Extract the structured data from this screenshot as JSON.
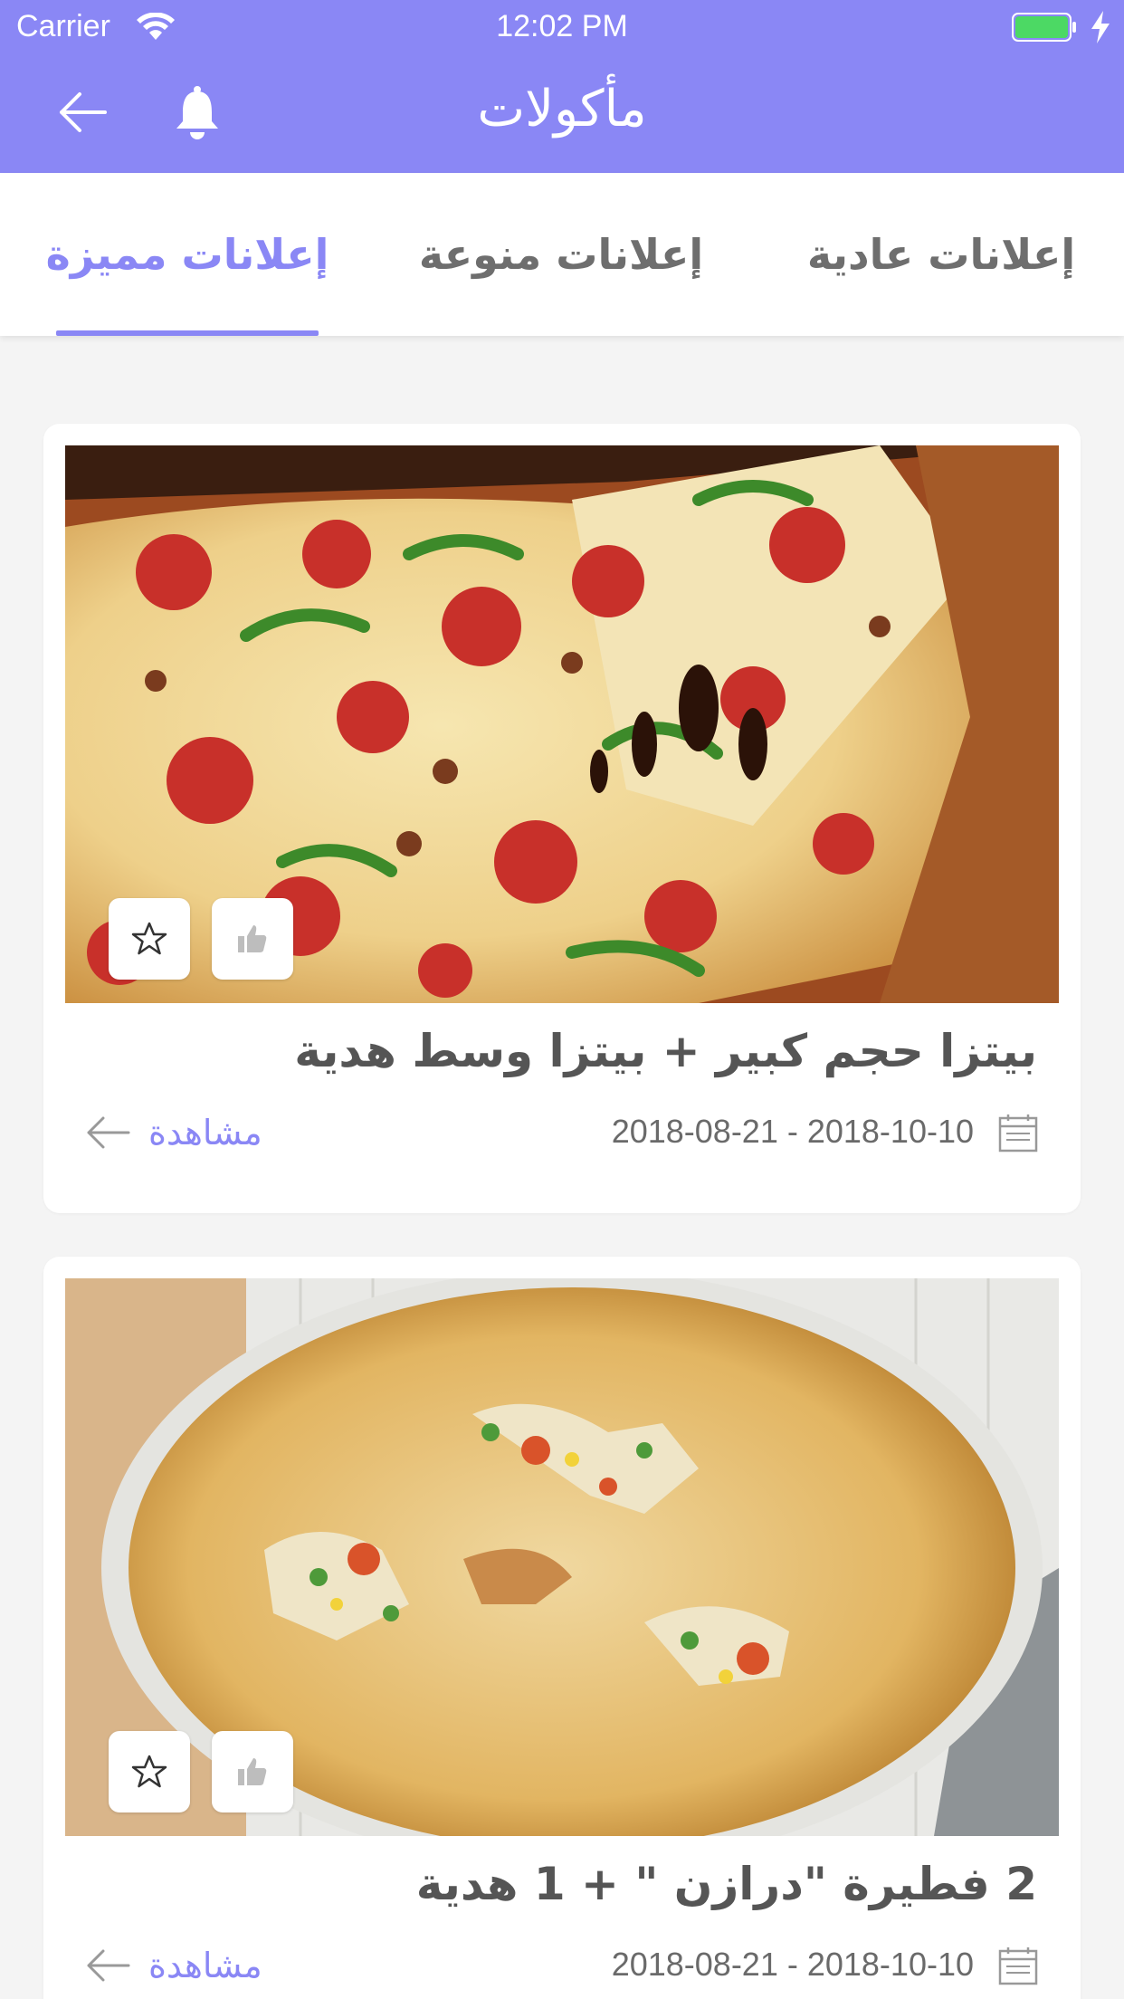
{
  "status_bar": {
    "carrier": "Carrier",
    "time": "12:02 PM"
  },
  "nav": {
    "title": "مأكولات",
    "back_icon": "back-arrow-icon",
    "bell_icon": "bell-icon"
  },
  "tabs": [
    {
      "label": "إعلانات مميزة",
      "active": true
    },
    {
      "label": "إعلانات منوعة",
      "active": false
    },
    {
      "label": "إعلانات عادية",
      "active": false
    }
  ],
  "colors": {
    "accent": "#8a87f5",
    "background": "#f4f4f4",
    "card": "#ffffff",
    "battery": "#4cd964"
  },
  "cards": [
    {
      "title": "بيتزا حجم كبير + بيتزا وسط هدية",
      "date_range": "2018-08-21  -  2018-10-10",
      "view_label": "مشاهدة",
      "image": "pizza-photo"
    },
    {
      "title": "2 فطيرة \"درازن \" + 1 هدية",
      "date_range": "2018-08-21  -  2018-10-10",
      "view_label": "مشاهدة",
      "image": "pie-photo"
    }
  ]
}
